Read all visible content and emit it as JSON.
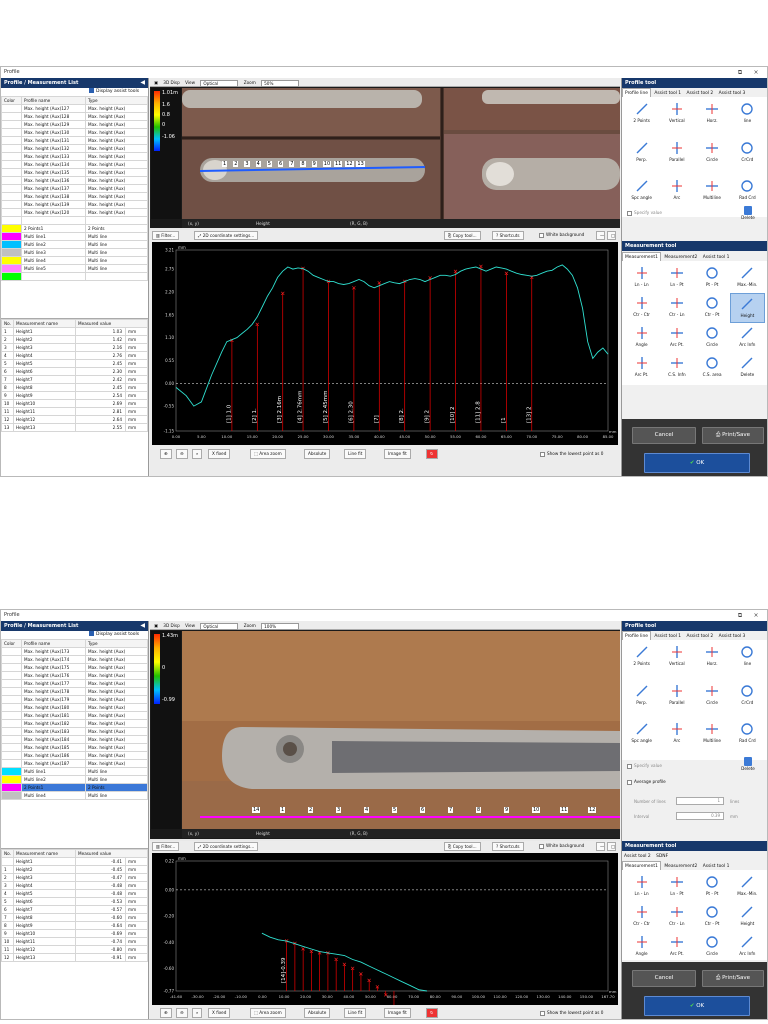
{
  "window_title": "Profile",
  "window_controls": [
    "⧉",
    "×"
  ],
  "left_panel": {
    "title": "Profile / Measurement List",
    "display_assist": "Display assist tools"
  },
  "profile_table": {
    "headers": [
      "Color",
      "Profile name",
      "Type"
    ]
  },
  "meas_table": {
    "headers": [
      "No.",
      "Measurement name",
      "Measured value"
    ]
  },
  "toolbar": {
    "three_d": "3D Disp",
    "view": "View",
    "zoom": "Zoom"
  },
  "image_footer": {
    "xy": "(x, y)",
    "height": "Height",
    "rgb": "(R, G, B)"
  },
  "plot_toolbar": {
    "filter": "Filter...",
    "coord": "2D coordinate settings...",
    "copy": "Copy tool...",
    "shortcuts": "Shortcuts",
    "white_bg": "White background"
  },
  "plot_footer": {
    "xfixed": "X fixed",
    "area_zoom": "Area zoom",
    "absolute": "Absolute",
    "line_fit": "Line fit",
    "image_fit": "Image fit",
    "lowest": "Show the lowest point as 0"
  },
  "profile_tool": {
    "title": "Profile tool",
    "tabs": [
      "Profile line",
      "Assist tool 1",
      "Assist tool 2",
      "Assist tool 3"
    ],
    "tools": [
      "2 Points",
      "Vertical",
      "Horz.",
      "line",
      "Perp.",
      "Parallel",
      "Circle",
      "CrCrd",
      "Spc angle",
      "Arc",
      "Multiline",
      "Rad Crd"
    ],
    "specify": "Specify value",
    "delete": "Delete",
    "avg_profile": "Average profile",
    "num_lines": "Number of lines",
    "num_lines_val": "1",
    "num_lines_unit": "lines",
    "interval": "Interval",
    "interval_val": "0.39",
    "interval_unit": "mm"
  },
  "measurement_tool": {
    "title": "Measurement tool",
    "tabs_row1": [
      "Assist tool 2",
      "SDNF"
    ],
    "tabs_row2": [
      "Measurement1",
      "Measurement2",
      "Assist tool 1"
    ],
    "tools": [
      "Ln - Ln",
      "Ln - Pt",
      "Pt - Pt",
      "Max.-Min.",
      "Ctr - Ctr",
      "Ctr - Ln",
      "Ctr - Pt",
      "Height",
      "Angle",
      "Arc Pt.",
      "Circle",
      "Arc Infn",
      "Arc Pt.",
      "C.S. Infn",
      "C.S. area",
      "Delete"
    ],
    "cancel": "Cancel",
    "print": "Print/Save",
    "ok": "OK"
  },
  "win1": {
    "view_value": "Optical",
    "zoom_value": "50%",
    "colorbar_ticks": [
      "1.01m",
      "1.6",
      "0.8",
      "0",
      "-1.06"
    ],
    "profiles": [
      {
        "color": "#ffffff",
        "name": "Max. height (Aux)127",
        "type": "Max. height (Aux)"
      },
      {
        "color": "#ffffff",
        "name": "Max. height (Aux)128",
        "type": "Max. height (Aux)"
      },
      {
        "color": "#ffffff",
        "name": "Max. height (Aux)129",
        "type": "Max. height (Aux)"
      },
      {
        "color": "#ffffff",
        "name": "Max. height (Aux)130",
        "type": "Max. height (Aux)"
      },
      {
        "color": "#ffffff",
        "name": "Max. height (Aux)131",
        "type": "Max. height (Aux)"
      },
      {
        "color": "#ffffff",
        "name": "Max. height (Aux)132",
        "type": "Max. height (Aux)"
      },
      {
        "color": "#ffffff",
        "name": "Max. height (Aux)133",
        "type": "Max. height (Aux)"
      },
      {
        "color": "#ffffff",
        "name": "Max. height (Aux)134",
        "type": "Max. height (Aux)"
      },
      {
        "color": "#ffffff",
        "name": "Max. height (Aux)135",
        "type": "Max. height (Aux)"
      },
      {
        "color": "#ffffff",
        "name": "Max. height (Aux)136",
        "type": "Max. height (Aux)"
      },
      {
        "color": "#ffffff",
        "name": "Max. height (Aux)137",
        "type": "Max. height (Aux)"
      },
      {
        "color": "#ffffff",
        "name": "Max. height (Aux)138",
        "type": "Max. height (Aux)"
      },
      {
        "color": "#ffffff",
        "name": "Max. height (Aux)139",
        "type": "Max. height (Aux)"
      },
      {
        "color": "#ffffff",
        "name": "Max. height (Aux)120",
        "type": "Max. height (Aux)"
      },
      {
        "color": "#ffffff",
        "name": "",
        "type": ""
      },
      {
        "color": "#ffff00",
        "name": "2 Points1",
        "type": "2 Points"
      },
      {
        "color": "#ff00ff",
        "name": "Multi line1",
        "type": "Multi line"
      },
      {
        "color": "#00c0ff",
        "name": "Multi line2",
        "type": "Multi line"
      },
      {
        "color": "#c0c0c0",
        "name": "Multi line3",
        "type": "Multi line"
      },
      {
        "color": "#ffff00",
        "name": "Multi line4",
        "type": "Multi line"
      },
      {
        "color": "#ff80ff",
        "name": "Multi line5",
        "type": "Multi line"
      },
      {
        "color": "#00ff00",
        "name": "",
        "type": ""
      }
    ],
    "measurements": [
      {
        "no": "1",
        "name": "Height1",
        "value": "1.03",
        "unit": "mm"
      },
      {
        "no": "2",
        "name": "Height2",
        "value": "1.42",
        "unit": "mm"
      },
      {
        "no": "3",
        "name": "Height3",
        "value": "2.16",
        "unit": "mm"
      },
      {
        "no": "4",
        "name": "Height4",
        "value": "2.76",
        "unit": "mm"
      },
      {
        "no": "5",
        "name": "Height5",
        "value": "2.45",
        "unit": "mm"
      },
      {
        "no": "6",
        "name": "Height6",
        "value": "2.30",
        "unit": "mm"
      },
      {
        "no": "7",
        "name": "Height7",
        "value": "2.42",
        "unit": "mm"
      },
      {
        "no": "8",
        "name": "Height8",
        "value": "2.45",
        "unit": "mm"
      },
      {
        "no": "9",
        "name": "Height9",
        "value": "2.54",
        "unit": "mm"
      },
      {
        "no": "10",
        "name": "Height10",
        "value": "2.69",
        "unit": "mm"
      },
      {
        "no": "11",
        "name": "Height11",
        "value": "2.81",
        "unit": "mm"
      },
      {
        "no": "12",
        "name": "Height12",
        "value": "2.64",
        "unit": "mm"
      },
      {
        "no": "13",
        "name": "Height13",
        "value": "2.55",
        "unit": "mm"
      }
    ],
    "photo_labels": [
      "1",
      "2",
      "3",
      "4",
      "5",
      "6",
      "7",
      "8",
      "9",
      "10",
      "11",
      "12",
      "13"
    ],
    "axis_unit": "mm",
    "chart_data": {
      "type": "line",
      "xlabel": "",
      "ylabel": "",
      "unit_label": "mm",
      "xlim": [
        0,
        85
      ],
      "ylim": [
        -1.15,
        3.21
      ],
      "x_ticks": [
        "0.00",
        "5.00",
        "10.00",
        "15.00",
        "20.00",
        "25.00",
        "30.00",
        "35.00",
        "40.00",
        "45.00",
        "50.00",
        "55.00",
        "60.00",
        "65.00",
        "70.00",
        "75.00",
        "80.00",
        "85.00"
      ],
      "y_ticks": [
        3.21,
        2.75,
        2.2,
        1.65,
        1.1,
        0.55,
        0.0,
        -0.55,
        -1.15
      ],
      "y_tick_labels": [
        "3.21",
        "2.75",
        "2.20",
        "1.65",
        "1.10",
        "0.55",
        "0.00",
        "-0.55",
        "-1.15"
      ],
      "reference_line": 0.0,
      "series": [
        {
          "x": [
            0,
            2,
            3.5,
            5,
            7,
            9,
            10,
            11,
            12,
            13,
            14,
            15,
            16,
            17,
            18,
            19,
            20,
            21,
            22,
            23,
            24,
            25,
            26,
            27,
            28,
            29,
            30,
            31,
            32,
            33,
            34,
            35,
            36,
            37,
            38,
            39,
            40,
            41,
            42,
            43,
            44,
            45,
            46,
            47,
            48,
            49,
            50,
            51,
            52,
            53,
            54,
            55,
            56,
            57,
            58,
            59,
            60,
            61,
            62,
            63,
            64,
            65,
            66,
            67,
            68,
            69,
            70,
            71,
            72,
            73,
            74,
            75,
            76,
            77,
            78,
            79,
            80,
            81,
            82,
            83,
            84,
            85
          ],
          "y": [
            -0.1,
            -0.3,
            -0.55,
            -0.45,
            0.2,
            0.75,
            1.0,
            1.05,
            1.1,
            1.2,
            1.3,
            1.42,
            1.6,
            1.85,
            2.1,
            2.3,
            2.55,
            2.7,
            2.8,
            2.75,
            2.78,
            2.76,
            2.7,
            2.6,
            2.55,
            2.5,
            2.45,
            2.45,
            2.4,
            2.38,
            2.4,
            2.45,
            2.5,
            2.45,
            2.35,
            2.3,
            2.35,
            2.4,
            2.45,
            2.42,
            2.4,
            2.45,
            2.5,
            2.52,
            2.5,
            2.45,
            2.5,
            2.55,
            2.6,
            2.6,
            2.58,
            2.62,
            2.7,
            2.75,
            2.78,
            2.8,
            2.75,
            2.7,
            2.75,
            2.8,
            2.78,
            2.75,
            2.7,
            2.65,
            2.62,
            2.6,
            2.58,
            2.6,
            2.65,
            2.7,
            2.72,
            2.8,
            2.85,
            2.75,
            2.6,
            2.3,
            1.8,
            1.0,
            0.6,
            0.75,
            0.85,
            0.7
          ]
        }
      ],
      "markers": [
        {
          "x": 11,
          "y": 1.03,
          "label": "[1] 1.0"
        },
        {
          "x": 16,
          "y": 1.42,
          "label": "[2] 1."
        },
        {
          "x": 21,
          "y": 2.16,
          "label": "[3] 2.16m"
        },
        {
          "x": 25,
          "y": 2.76,
          "label": "[4] 2.76mm"
        },
        {
          "x": 30,
          "y": 2.45,
          "label": "[5] 2.45mm"
        },
        {
          "x": 35,
          "y": 2.3,
          "label": "[6] 2.30"
        },
        {
          "x": 40,
          "y": 2.42,
          "label": "[7]"
        },
        {
          "x": 45,
          "y": 2.45,
          "label": "[8] 2."
        },
        {
          "x": 50,
          "y": 2.54,
          "label": "[9] 2"
        },
        {
          "x": 55,
          "y": 2.69,
          "label": "[10] 2"
        },
        {
          "x": 60,
          "y": 2.81,
          "label": "[11] 2.8"
        },
        {
          "x": 65,
          "y": 2.64,
          "label": "[1"
        },
        {
          "x": 70,
          "y": 2.55,
          "label": "[13] 2"
        }
      ]
    }
  },
  "win2": {
    "view_value": "Optical",
    "zoom_value": "100%",
    "colorbar_ticks": [
      "1.43m",
      "0",
      "-0.99"
    ],
    "profiles": [
      {
        "color": "#ffffff",
        "name": "Max. height (Aux)173",
        "type": "Max. height (Aux)"
      },
      {
        "color": "#ffffff",
        "name": "Max. height (Aux)174",
        "type": "Max. height (Aux)"
      },
      {
        "color": "#ffffff",
        "name": "Max. height (Aux)175",
        "type": "Max. height (Aux)"
      },
      {
        "color": "#ffffff",
        "name": "Max. height (Aux)176",
        "type": "Max. height (Aux)"
      },
      {
        "color": "#ffffff",
        "name": "Max. height (Aux)177",
        "type": "Max. height (Aux)"
      },
      {
        "color": "#ffffff",
        "name": "Max. height (Aux)178",
        "type": "Max. height (Aux)"
      },
      {
        "color": "#ffffff",
        "name": "Max. height (Aux)179",
        "type": "Max. height (Aux)"
      },
      {
        "color": "#ffffff",
        "name": "Max. height (Aux)180",
        "type": "Max. height (Aux)"
      },
      {
        "color": "#ffffff",
        "name": "Max. height (Aux)181",
        "type": "Max. height (Aux)"
      },
      {
        "color": "#ffffff",
        "name": "Max. height (Aux)182",
        "type": "Max. height (Aux)"
      },
      {
        "color": "#ffffff",
        "name": "Max. height (Aux)183",
        "type": "Max. height (Aux)"
      },
      {
        "color": "#ffffff",
        "name": "Max. height (Aux)184",
        "type": "Max. height (Aux)"
      },
      {
        "color": "#ffffff",
        "name": "Max. height (Aux)185",
        "type": "Max. height (Aux)"
      },
      {
        "color": "#ffffff",
        "name": "Max. height (Aux)186",
        "type": "Max. height (Aux)"
      },
      {
        "color": "#ffffff",
        "name": "Max. height (Aux)187",
        "type": "Max. height (Aux)"
      },
      {
        "color": "#00e0ff",
        "name": "Multi line1",
        "type": "Multi line"
      },
      {
        "color": "#ffff00",
        "name": "Multi line2",
        "type": "Multi line"
      },
      {
        "color": "#ff00ff",
        "name": "2 Points1",
        "type": "2 Points",
        "selected": true
      },
      {
        "color": "#c0c0c0",
        "name": "Multi line4",
        "type": "Multi line"
      }
    ],
    "measurements": [
      {
        "no": "",
        "name": "Height1",
        "value": "-0.41",
        "unit": "mm"
      },
      {
        "no": "1",
        "name": "Height2",
        "value": "-0.45",
        "unit": "mm"
      },
      {
        "no": "2",
        "name": "Height3",
        "value": "-0.47",
        "unit": "mm"
      },
      {
        "no": "3",
        "name": "Height4",
        "value": "-0.48",
        "unit": "mm"
      },
      {
        "no": "4",
        "name": "Height5",
        "value": "-0.48",
        "unit": "mm"
      },
      {
        "no": "5",
        "name": "Height6",
        "value": "-0.53",
        "unit": "mm"
      },
      {
        "no": "6",
        "name": "Height7",
        "value": "-0.57",
        "unit": "mm"
      },
      {
        "no": "7",
        "name": "Height8",
        "value": "-0.60",
        "unit": "mm"
      },
      {
        "no": "8",
        "name": "Height9",
        "value": "-0.64",
        "unit": "mm"
      },
      {
        "no": "9",
        "name": "Height10",
        "value": "-0.69",
        "unit": "mm"
      },
      {
        "no": "10",
        "name": "Height11",
        "value": "-0.74",
        "unit": "mm"
      },
      {
        "no": "11",
        "name": "Height12",
        "value": "-0.80",
        "unit": "mm"
      },
      {
        "no": "12",
        "name": "Height13",
        "value": "-0.91",
        "unit": "mm"
      }
    ],
    "photo_labels": [
      "14",
      "1",
      "2",
      "3",
      "4",
      "5",
      "6",
      "7",
      "8",
      "9",
      "10",
      "11",
      "12"
    ],
    "axis_unit": "mm",
    "chart_data": {
      "type": "line",
      "xlabel": "",
      "ylabel": "",
      "unit_label": "mm",
      "xlim": [
        -41.6,
        167.7
      ],
      "ylim": [
        -0.77,
        0.22
      ],
      "x_ticks": [
        "-41.60",
        "-30.00",
        "-20.00",
        "-10.00",
        "0.00",
        "10.00",
        "20.00",
        "30.00",
        "40.00",
        "50.00",
        "60.00",
        "70.00",
        "80.00",
        "90.00",
        "100.00",
        "110.00",
        "120.00",
        "130.00",
        "140.00",
        "150.00",
        "167.70"
      ],
      "y_ticks": [
        0.22,
        0.0,
        -0.2,
        -0.4,
        -0.6,
        -0.77
      ],
      "y_tick_labels": [
        "0.22",
        "0.00",
        "-0.20",
        "-0.40",
        "-0.60",
        "-0.77"
      ],
      "reference_line": 0.0,
      "series": [
        {
          "x": [
            0,
            4,
            8,
            12,
            16,
            20,
            24,
            28,
            32,
            36,
            40,
            44,
            48,
            52,
            56,
            60,
            64,
            68,
            72,
            76,
            80
          ],
          "y": [
            -0.33,
            -0.36,
            -0.38,
            -0.39,
            -0.41,
            -0.43,
            -0.45,
            -0.47,
            -0.48,
            -0.49,
            -0.5,
            -0.53,
            -0.55,
            -0.58,
            -0.61,
            -0.64,
            -0.67,
            -0.7,
            -0.73,
            -0.76,
            -0.77
          ]
        }
      ],
      "markers": [
        {
          "x": 12,
          "y": -0.39,
          "label": "[14]-0.39"
        },
        {
          "x": 16,
          "y": -0.41,
          "label": ""
        },
        {
          "x": 20,
          "y": -0.45,
          "label": ""
        },
        {
          "x": 24,
          "y": -0.47,
          "label": ""
        },
        {
          "x": 28,
          "y": -0.48,
          "label": ""
        },
        {
          "x": 32,
          "y": -0.48,
          "label": ""
        },
        {
          "x": 36,
          "y": -0.53,
          "label": ""
        },
        {
          "x": 40,
          "y": -0.57,
          "label": ""
        },
        {
          "x": 44,
          "y": -0.6,
          "label": ""
        },
        {
          "x": 48,
          "y": -0.64,
          "label": ""
        },
        {
          "x": 52,
          "y": -0.69,
          "label": ""
        },
        {
          "x": 56,
          "y": -0.74,
          "label": ""
        },
        {
          "x": 60,
          "y": -0.8,
          "label": ""
        },
        {
          "x": 64,
          "y": -0.91,
          "label": ""
        }
      ]
    }
  }
}
